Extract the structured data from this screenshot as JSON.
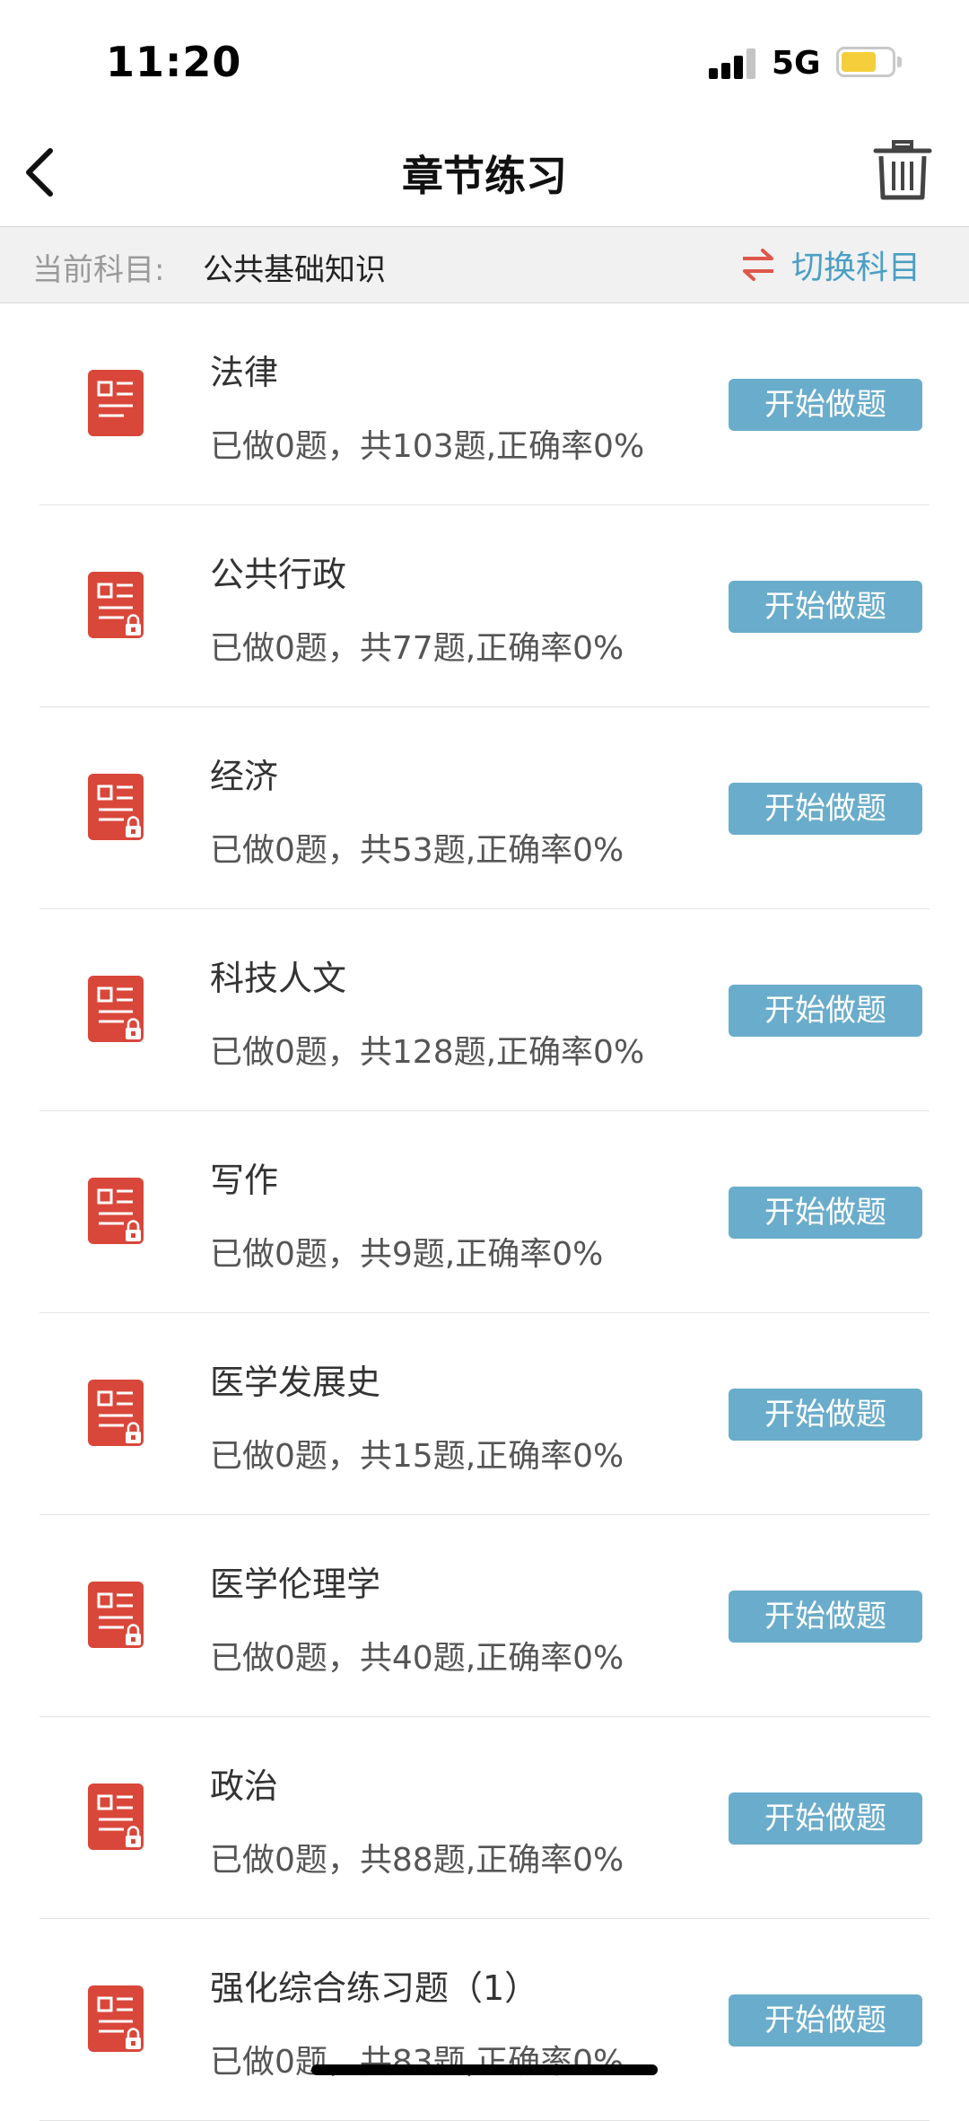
{
  "status_bar": {
    "time": "11:20",
    "network": "5G",
    "battery_level": 0.7
  },
  "nav": {
    "title": "章节练习",
    "back_icon": "chevron-left-icon",
    "trash_icon": "trash-icon"
  },
  "subject": {
    "label": "当前科目:",
    "value": "公共基础知识",
    "switch_label": "切换科目",
    "switch_icon": "swap-arrows-icon"
  },
  "colors": {
    "accent_blue": "#4b9fc4",
    "button_blue": "#6aaccb",
    "icon_red": "#d9473a"
  },
  "chapters": [
    {
      "title": "法律",
      "stats": "已做0题，共103题,正确率0%",
      "button": "开始做题",
      "locked": false
    },
    {
      "title": "公共行政",
      "stats": "已做0题，共77题,正确率0%",
      "button": "开始做题",
      "locked": true
    },
    {
      "title": "经济",
      "stats": "已做0题，共53题,正确率0%",
      "button": "开始做题",
      "locked": true
    },
    {
      "title": "科技人文",
      "stats": "已做0题，共128题,正确率0%",
      "button": "开始做题",
      "locked": true
    },
    {
      "title": "写作",
      "stats": "已做0题，共9题,正确率0%",
      "button": "开始做题",
      "locked": true
    },
    {
      "title": "医学发展史",
      "stats": "已做0题，共15题,正确率0%",
      "button": "开始做题",
      "locked": true
    },
    {
      "title": "医学伦理学",
      "stats": "已做0题，共40题,正确率0%",
      "button": "开始做题",
      "locked": true
    },
    {
      "title": "政治",
      "stats": "已做0题，共88题,正确率0%",
      "button": "开始做题",
      "locked": true
    },
    {
      "title": "强化综合练习题（1）",
      "stats": "已做0题，共83题,正确率0%",
      "button": "开始做题",
      "locked": true
    }
  ]
}
